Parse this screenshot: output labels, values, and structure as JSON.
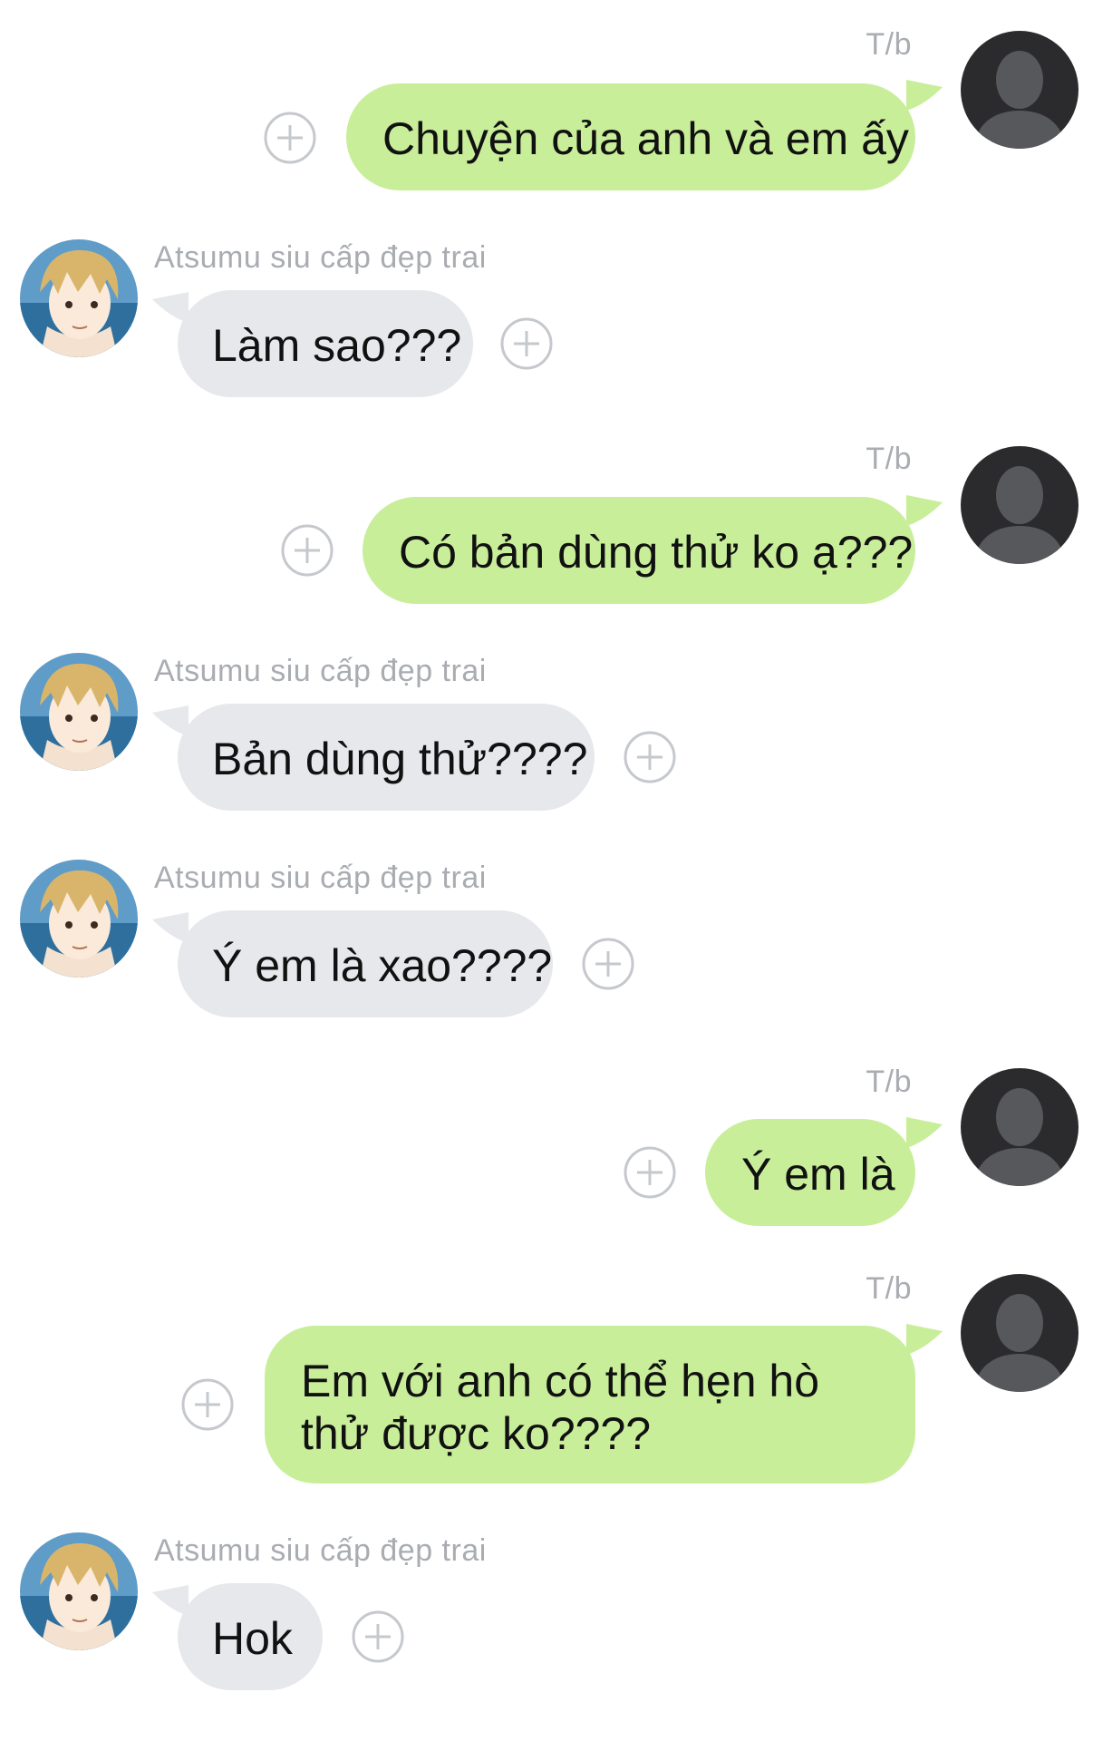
{
  "contacts": {
    "me": {
      "label": "T/b"
    },
    "other": {
      "name": "Atsumu siu cấp đẹp trai"
    }
  },
  "messages": [
    {
      "from": "me",
      "text": "Chuyện của anh và em ấy"
    },
    {
      "from": "other",
      "text": "Làm sao???"
    },
    {
      "from": "me",
      "text": "Có bản dùng thử ko ạ???"
    },
    {
      "from": "other",
      "text": "Bản dùng thử????"
    },
    {
      "from": "other",
      "text": "Ý em là xao????"
    },
    {
      "from": "me",
      "text": "Ý em là"
    },
    {
      "from": "me",
      "text": "Em với anh có thể hẹn hò thử được ko????"
    },
    {
      "from": "other",
      "text": "Hok"
    }
  ],
  "icons": {
    "add": "plus-circle-icon",
    "me_avatar": "default-user-avatar-icon",
    "other_avatar": "anime-avatar-icon"
  },
  "colors": {
    "outgoing_bubble": "#c8ee9a",
    "incoming_bubble": "#e6e8eb",
    "sender_text": "#a9acb1",
    "plus_icon": "#c5c8cc",
    "default_avatar_bg": "#2b2b2d",
    "default_avatar_fg": "#57585c"
  }
}
